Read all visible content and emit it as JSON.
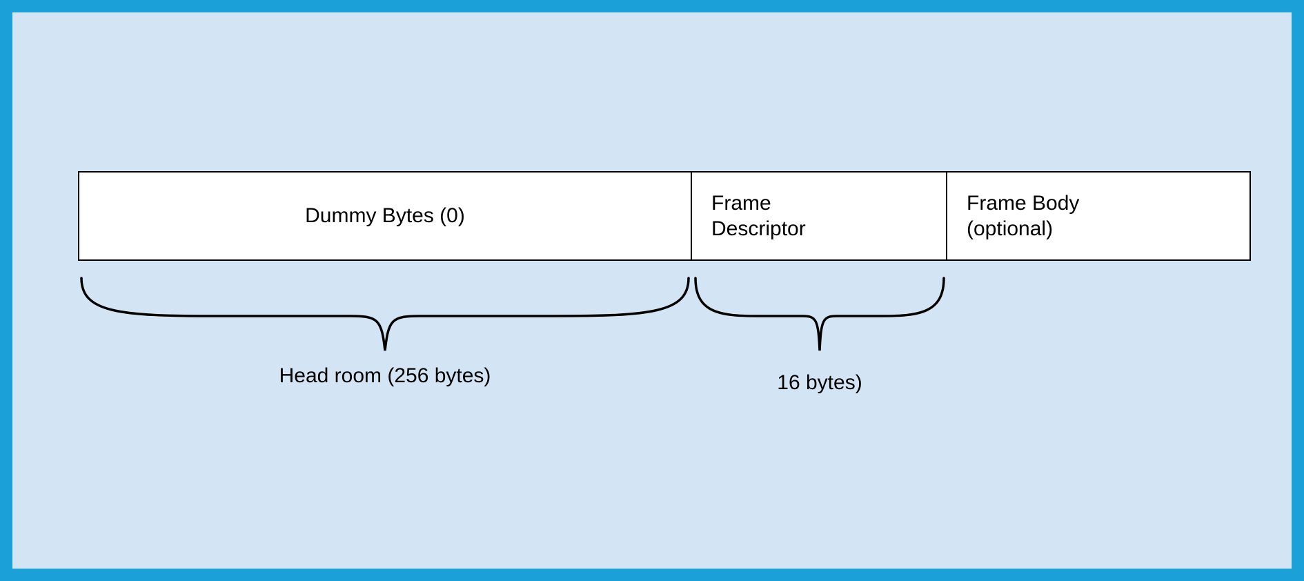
{
  "frame": {
    "dummy_label": "Dummy Bytes (0)",
    "descriptor_label": "Frame\nDescriptor",
    "body_label": "Frame Body\n(optional)"
  },
  "braces": {
    "headroom_label": "Head room (256 bytes)",
    "descriptor_size_label": "16 bytes)"
  }
}
